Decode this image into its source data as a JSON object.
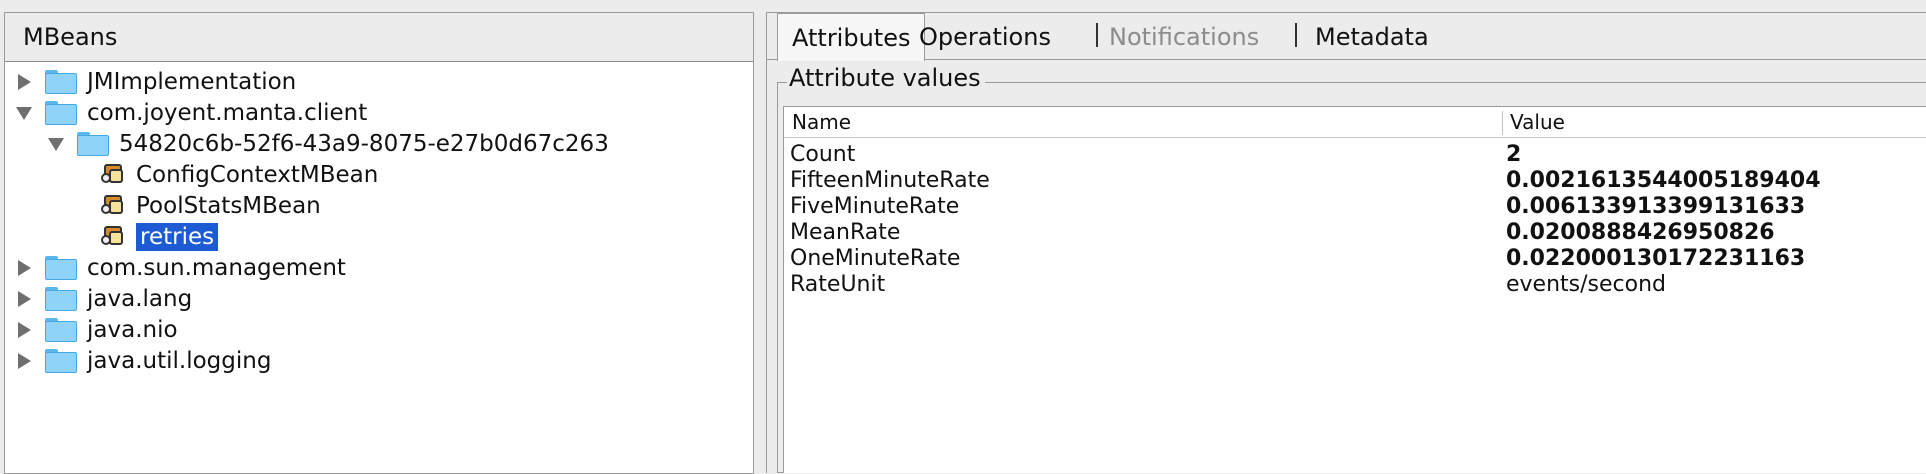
{
  "left": {
    "header": "MBeans",
    "tree": [
      {
        "label": "JMImplementation",
        "type": "folder",
        "expand": "collapsed",
        "indent": 0
      },
      {
        "label": "com.joyent.manta.client",
        "type": "folder",
        "expand": "expanded",
        "indent": 0
      },
      {
        "label": "54820c6b-52f6-43a9-8075-e27b0d67c263",
        "type": "folder",
        "expand": "expanded",
        "indent": 1
      },
      {
        "label": "ConfigContextMBean",
        "type": "bean",
        "expand": "none",
        "indent": 2
      },
      {
        "label": "PoolStatsMBean",
        "type": "bean",
        "expand": "none",
        "indent": 2
      },
      {
        "label": "retries",
        "type": "bean",
        "expand": "none",
        "indent": 2,
        "selected": true
      },
      {
        "label": "com.sun.management",
        "type": "folder",
        "expand": "collapsed",
        "indent": 0
      },
      {
        "label": "java.lang",
        "type": "folder",
        "expand": "collapsed",
        "indent": 0
      },
      {
        "label": "java.nio",
        "type": "folder",
        "expand": "collapsed",
        "indent": 0
      },
      {
        "label": "java.util.logging",
        "type": "folder",
        "expand": "collapsed",
        "indent": 0
      }
    ]
  },
  "right": {
    "tabs": [
      {
        "label": "Attributes",
        "state": "active"
      },
      {
        "label": "Operations",
        "state": "normal"
      },
      {
        "label": "Notifications",
        "state": "disabled"
      },
      {
        "label": "Metadata",
        "state": "normal"
      }
    ],
    "group_title": "Attribute values",
    "columns": {
      "name": "Name",
      "value": "Value"
    },
    "rows": [
      {
        "name": "Count",
        "value": "2",
        "bold": true
      },
      {
        "name": "FifteenMinuteRate",
        "value": "0.0021613544005189404",
        "bold": true
      },
      {
        "name": "FiveMinuteRate",
        "value": "0.006133913399131633",
        "bold": true
      },
      {
        "name": "MeanRate",
        "value": "0.0200888426950826",
        "bold": true
      },
      {
        "name": "OneMinuteRate",
        "value": "0.022000130172231163",
        "bold": true
      },
      {
        "name": "RateUnit",
        "value": "events/second",
        "bold": false
      }
    ]
  },
  "colors": {
    "selection": "#1c5bd4",
    "folder": "#8fd3f8"
  }
}
